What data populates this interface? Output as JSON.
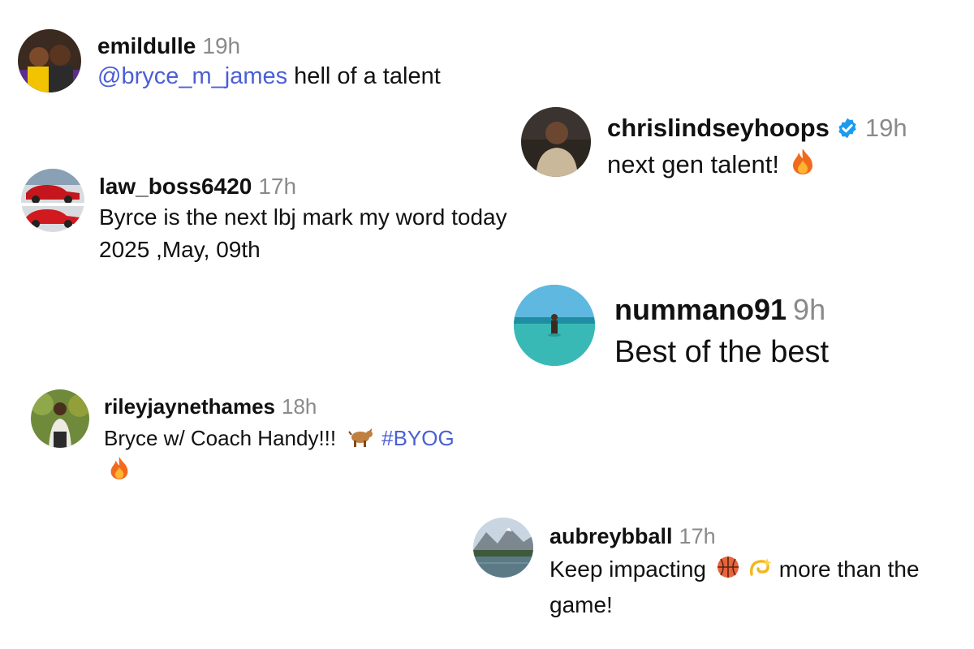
{
  "colors": {
    "link": "#4a5fd6",
    "timestamp": "#8a8a8a",
    "verified": "#1d9bf0",
    "text": "#111111"
  },
  "comments": [
    {
      "username": "emildulle",
      "time": "19h",
      "mention": "@bryce_m_james",
      "text": " hell of a talent",
      "avatar_icon": "two-people-photo"
    },
    {
      "username": "chrislindseyhoops",
      "verified": true,
      "verified_icon": "verified-badge-icon",
      "time": "19h",
      "text": "next gen talent!",
      "emoji": "fire-emoji",
      "avatar_icon": "person-photo"
    },
    {
      "username": "law_boss6420",
      "time": "17h",
      "text": "Byrce is the next lbj mark my word today 2025 ,May, 09th",
      "avatar_icon": "red-cars-photo"
    },
    {
      "username": "nummano91",
      "time": "9h",
      "text": "Best of the best",
      "avatar_icon": "person-in-water-photo"
    },
    {
      "username": "rileyjaynethames",
      "time": "18h",
      "text_before": "Bryce w/ Coach Handy!!!",
      "emoji_1": "goat-emoji",
      "hashtag": "#BYOG",
      "emoji_2": "fire-emoji",
      "avatar_icon": "person-outdoors-photo"
    },
    {
      "username": "aubreybball",
      "time": "17h",
      "text_before": "Keep impacting",
      "emoji_1": "basketball-emoji",
      "emoji_2": "dizzy-emoji",
      "text_after": " more than the game!",
      "avatar_icon": "mountain-lake-photo"
    }
  ]
}
